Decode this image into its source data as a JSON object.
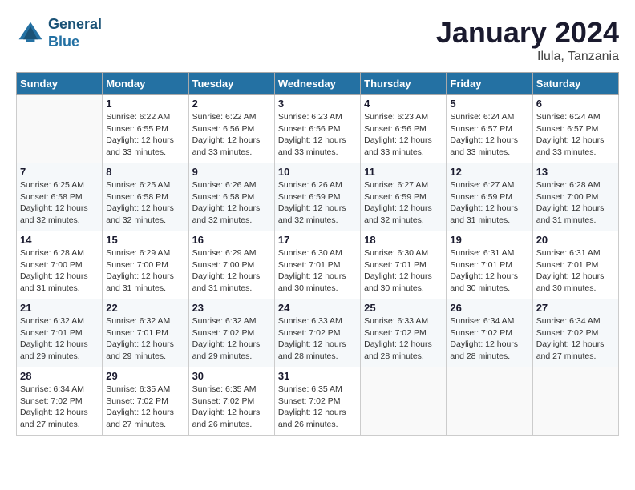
{
  "header": {
    "logo_line1": "General",
    "logo_line2": "Blue",
    "month_year": "January 2024",
    "location": "Ilula, Tanzania"
  },
  "days_of_week": [
    "Sunday",
    "Monday",
    "Tuesday",
    "Wednesday",
    "Thursday",
    "Friday",
    "Saturday"
  ],
  "weeks": [
    [
      {
        "day": "",
        "sunrise": "",
        "sunset": "",
        "daylight": ""
      },
      {
        "day": "1",
        "sunrise": "Sunrise: 6:22 AM",
        "sunset": "Sunset: 6:55 PM",
        "daylight": "Daylight: 12 hours and 33 minutes."
      },
      {
        "day": "2",
        "sunrise": "Sunrise: 6:22 AM",
        "sunset": "Sunset: 6:56 PM",
        "daylight": "Daylight: 12 hours and 33 minutes."
      },
      {
        "day": "3",
        "sunrise": "Sunrise: 6:23 AM",
        "sunset": "Sunset: 6:56 PM",
        "daylight": "Daylight: 12 hours and 33 minutes."
      },
      {
        "day": "4",
        "sunrise": "Sunrise: 6:23 AM",
        "sunset": "Sunset: 6:56 PM",
        "daylight": "Daylight: 12 hours and 33 minutes."
      },
      {
        "day": "5",
        "sunrise": "Sunrise: 6:24 AM",
        "sunset": "Sunset: 6:57 PM",
        "daylight": "Daylight: 12 hours and 33 minutes."
      },
      {
        "day": "6",
        "sunrise": "Sunrise: 6:24 AM",
        "sunset": "Sunset: 6:57 PM",
        "daylight": "Daylight: 12 hours and 33 minutes."
      }
    ],
    [
      {
        "day": "7",
        "sunrise": "Sunrise: 6:25 AM",
        "sunset": "Sunset: 6:58 PM",
        "daylight": "Daylight: 12 hours and 32 minutes."
      },
      {
        "day": "8",
        "sunrise": "Sunrise: 6:25 AM",
        "sunset": "Sunset: 6:58 PM",
        "daylight": "Daylight: 12 hours and 32 minutes."
      },
      {
        "day": "9",
        "sunrise": "Sunrise: 6:26 AM",
        "sunset": "Sunset: 6:58 PM",
        "daylight": "Daylight: 12 hours and 32 minutes."
      },
      {
        "day": "10",
        "sunrise": "Sunrise: 6:26 AM",
        "sunset": "Sunset: 6:59 PM",
        "daylight": "Daylight: 12 hours and 32 minutes."
      },
      {
        "day": "11",
        "sunrise": "Sunrise: 6:27 AM",
        "sunset": "Sunset: 6:59 PM",
        "daylight": "Daylight: 12 hours and 32 minutes."
      },
      {
        "day": "12",
        "sunrise": "Sunrise: 6:27 AM",
        "sunset": "Sunset: 6:59 PM",
        "daylight": "Daylight: 12 hours and 31 minutes."
      },
      {
        "day": "13",
        "sunrise": "Sunrise: 6:28 AM",
        "sunset": "Sunset: 7:00 PM",
        "daylight": "Daylight: 12 hours and 31 minutes."
      }
    ],
    [
      {
        "day": "14",
        "sunrise": "Sunrise: 6:28 AM",
        "sunset": "Sunset: 7:00 PM",
        "daylight": "Daylight: 12 hours and 31 minutes."
      },
      {
        "day": "15",
        "sunrise": "Sunrise: 6:29 AM",
        "sunset": "Sunset: 7:00 PM",
        "daylight": "Daylight: 12 hours and 31 minutes."
      },
      {
        "day": "16",
        "sunrise": "Sunrise: 6:29 AM",
        "sunset": "Sunset: 7:00 PM",
        "daylight": "Daylight: 12 hours and 31 minutes."
      },
      {
        "day": "17",
        "sunrise": "Sunrise: 6:30 AM",
        "sunset": "Sunset: 7:01 PM",
        "daylight": "Daylight: 12 hours and 30 minutes."
      },
      {
        "day": "18",
        "sunrise": "Sunrise: 6:30 AM",
        "sunset": "Sunset: 7:01 PM",
        "daylight": "Daylight: 12 hours and 30 minutes."
      },
      {
        "day": "19",
        "sunrise": "Sunrise: 6:31 AM",
        "sunset": "Sunset: 7:01 PM",
        "daylight": "Daylight: 12 hours and 30 minutes."
      },
      {
        "day": "20",
        "sunrise": "Sunrise: 6:31 AM",
        "sunset": "Sunset: 7:01 PM",
        "daylight": "Daylight: 12 hours and 30 minutes."
      }
    ],
    [
      {
        "day": "21",
        "sunrise": "Sunrise: 6:32 AM",
        "sunset": "Sunset: 7:01 PM",
        "daylight": "Daylight: 12 hours and 29 minutes."
      },
      {
        "day": "22",
        "sunrise": "Sunrise: 6:32 AM",
        "sunset": "Sunset: 7:01 PM",
        "daylight": "Daylight: 12 hours and 29 minutes."
      },
      {
        "day": "23",
        "sunrise": "Sunrise: 6:32 AM",
        "sunset": "Sunset: 7:02 PM",
        "daylight": "Daylight: 12 hours and 29 minutes."
      },
      {
        "day": "24",
        "sunrise": "Sunrise: 6:33 AM",
        "sunset": "Sunset: 7:02 PM",
        "daylight": "Daylight: 12 hours and 28 minutes."
      },
      {
        "day": "25",
        "sunrise": "Sunrise: 6:33 AM",
        "sunset": "Sunset: 7:02 PM",
        "daylight": "Daylight: 12 hours and 28 minutes."
      },
      {
        "day": "26",
        "sunrise": "Sunrise: 6:34 AM",
        "sunset": "Sunset: 7:02 PM",
        "daylight": "Daylight: 12 hours and 28 minutes."
      },
      {
        "day": "27",
        "sunrise": "Sunrise: 6:34 AM",
        "sunset": "Sunset: 7:02 PM",
        "daylight": "Daylight: 12 hours and 27 minutes."
      }
    ],
    [
      {
        "day": "28",
        "sunrise": "Sunrise: 6:34 AM",
        "sunset": "Sunset: 7:02 PM",
        "daylight": "Daylight: 12 hours and 27 minutes."
      },
      {
        "day": "29",
        "sunrise": "Sunrise: 6:35 AM",
        "sunset": "Sunset: 7:02 PM",
        "daylight": "Daylight: 12 hours and 27 minutes."
      },
      {
        "day": "30",
        "sunrise": "Sunrise: 6:35 AM",
        "sunset": "Sunset: 7:02 PM",
        "daylight": "Daylight: 12 hours and 26 minutes."
      },
      {
        "day": "31",
        "sunrise": "Sunrise: 6:35 AM",
        "sunset": "Sunset: 7:02 PM",
        "daylight": "Daylight: 12 hours and 26 minutes."
      },
      {
        "day": "",
        "sunrise": "",
        "sunset": "",
        "daylight": ""
      },
      {
        "day": "",
        "sunrise": "",
        "sunset": "",
        "daylight": ""
      },
      {
        "day": "",
        "sunrise": "",
        "sunset": "",
        "daylight": ""
      }
    ]
  ]
}
